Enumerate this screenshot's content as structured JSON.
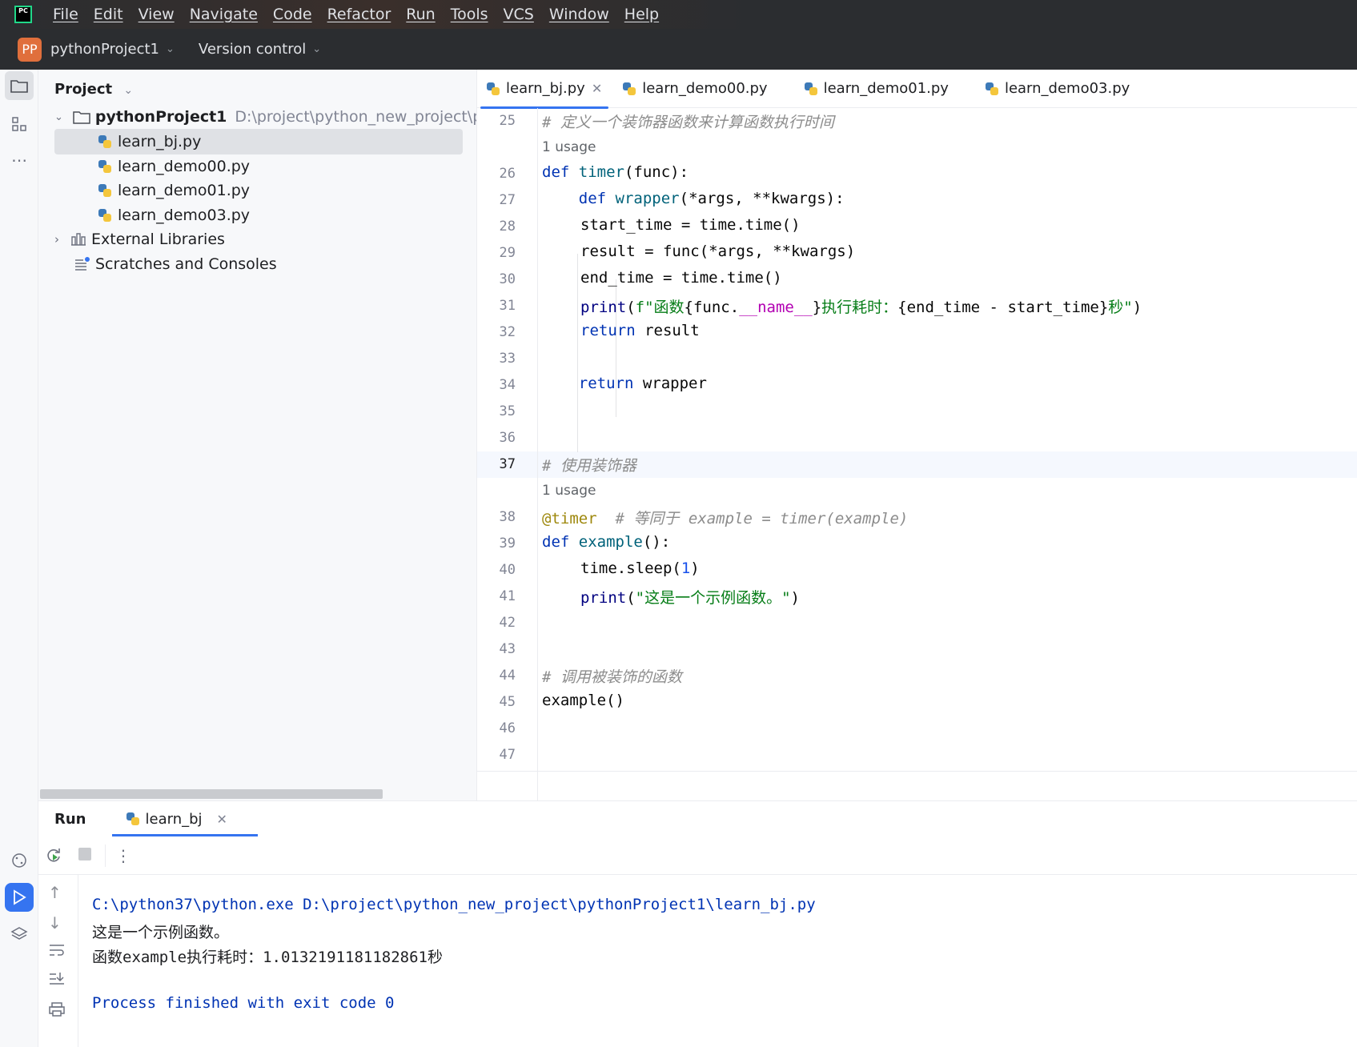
{
  "menu": {
    "logo_text": "PC",
    "items": [
      "File",
      "Edit",
      "View",
      "Navigate",
      "Code",
      "Refactor",
      "Run",
      "Tools",
      "VCS",
      "Window",
      "Help"
    ]
  },
  "titlebar": {
    "project_badge": "PP",
    "project_name": "pythonProject1",
    "version_control": "Version control"
  },
  "project_panel": {
    "title": "Project",
    "root_name": "pythonProject1",
    "root_path": "D:\\project\\python_new_project\\p",
    "files": [
      "learn_bj.py",
      "learn_demo00.py",
      "learn_demo01.py",
      "learn_demo03.py"
    ],
    "external_libraries": "External Libraries",
    "scratches": "Scratches and Consoles"
  },
  "editor": {
    "tabs": [
      "learn_bj.py",
      "learn_demo00.py",
      "learn_demo01.py",
      "learn_demo03.py"
    ],
    "active_tab": "learn_bj.py",
    "usage_hint": "1 usage",
    "line_numbers": [
      "25",
      "26",
      "27",
      "28",
      "29",
      "30",
      "31",
      "32",
      "33",
      "34",
      "35",
      "36",
      "37",
      "38",
      "39",
      "40",
      "41",
      "42",
      "43",
      "44",
      "45",
      "46",
      "47"
    ],
    "current_line": "37",
    "code": {
      "l25": "# 定义一个装饰器函数来计算函数执行时间",
      "l26_kw": "def",
      "l26_fn": "timer",
      "l26_rest": "(func):",
      "l27_kw": "def",
      "l27_fn": "wrapper",
      "l27_rest": "(*args, **kwargs):",
      "l28": "start_time = time.time()",
      "l29": "result = func(*args, **kwargs)",
      "l30": "end_time = time.time()",
      "l31_fn": "print",
      "l31_a": "(",
      "l31_b": "f\"函数",
      "l31_c": "{func.",
      "l31_d": "__name__",
      "l31_e": "}",
      "l31_f": "执行耗时：",
      "l31_g": "{end_time - start_time}",
      "l31_h": "秒\"",
      "l31_i": ")",
      "l32_kw": "return",
      "l32_rest": " result",
      "l34_kw": "return",
      "l34_rest": " wrapper",
      "l37": "# 使用装饰器",
      "l38_dec": "@timer",
      "l38_cm": "  # 等同于 example = timer(example)",
      "l39_kw": "def",
      "l39_fn": "example",
      "l39_rest": "():",
      "l40_a": "time.sleep(",
      "l40_n": "1",
      "l40_b": ")",
      "l41_fn": "print",
      "l41_a": "(",
      "l41_s": "\"这是一个示例函数。\"",
      "l41_b": ")",
      "l44": "# 调用被装饰的函数",
      "l45": "example()"
    }
  },
  "run_panel": {
    "title": "Run",
    "tab": "learn_bj",
    "output": {
      "cmd": "C:\\python37\\python.exe D:\\project\\python_new_project\\pythonProject1\\learn_bj.py",
      "line1": "这是一个示例函数。",
      "line2": "函数example执行耗时：1.0132191181182861秒",
      "exit": "Process finished with exit code 0"
    }
  }
}
